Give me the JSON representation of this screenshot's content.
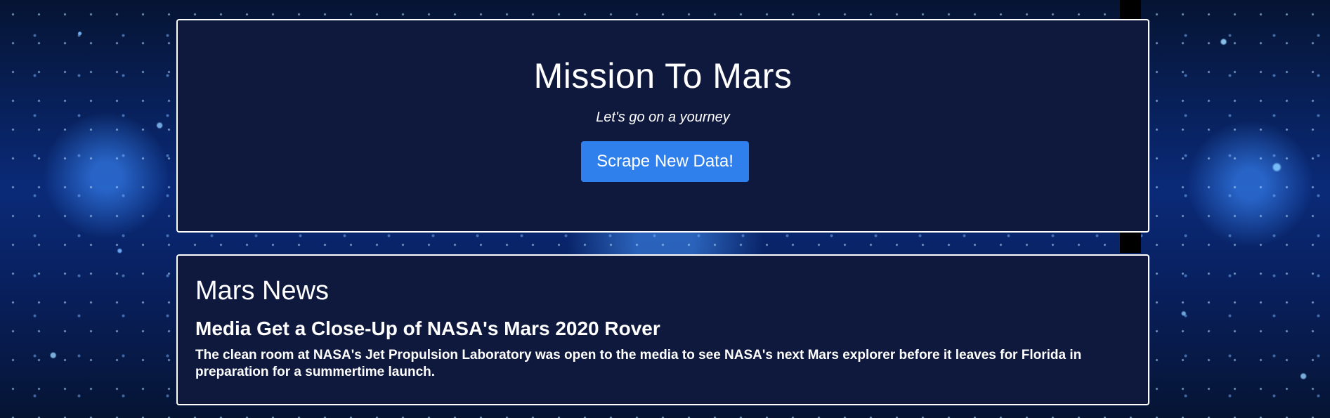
{
  "header": {
    "title": "Mission To Mars",
    "tagline": "Let's go on a yourney",
    "scrape_button_label": "Scrape New Data!"
  },
  "news": {
    "section_heading": "Mars News",
    "article_title": "Media Get a Close-Up of NASA's Mars 2020 Rover",
    "article_paragraph": "The clean room at NASA's Jet Propulsion Laboratory was open to the media to see NASA's next Mars explorer before it leaves for Florida in preparation for a summertime launch."
  },
  "colors": {
    "panel_background": "#0f193e",
    "panel_border": "#ffffff",
    "button_background": "#2f80ed",
    "page_background": "#0a2a78"
  }
}
